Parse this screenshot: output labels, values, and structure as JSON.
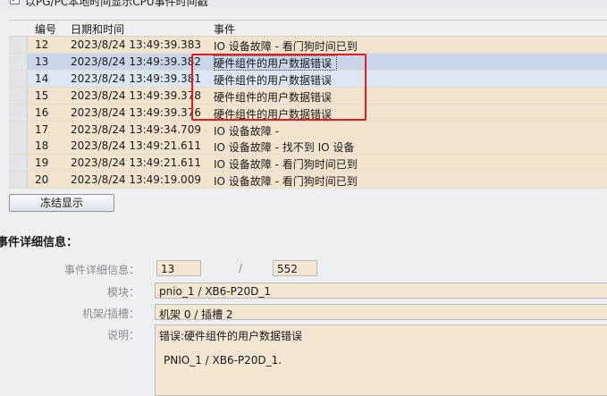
{
  "top": {
    "checkbox_mark": "✔",
    "label": "以PG/PC本地时间显示CPU事件时间戳"
  },
  "table": {
    "headers": {
      "number": "编号",
      "datetime": "日期和时间",
      "event": "事件"
    },
    "rows": [
      {
        "number": "12",
        "datetime": "2023/8/24 13:49:39.383",
        "event": "IO 设备故障 - 看门狗时间已到",
        "state": "normal"
      },
      {
        "number": "13",
        "datetime": "2023/8/24 13:49:39.382",
        "event": "硬件组件的用户数据错误",
        "state": "selected"
      },
      {
        "number": "14",
        "datetime": "2023/8/24 13:49:39.381",
        "event": "硬件组件的用户数据错误",
        "state": "highlight"
      },
      {
        "number": "15",
        "datetime": "2023/8/24 13:49:39.378",
        "event": "硬件组件的用户数据错误",
        "state": "normal"
      },
      {
        "number": "16",
        "datetime": "2023/8/24 13:49:39.376",
        "event": "硬件组件的用户数据错误",
        "state": "normal"
      },
      {
        "number": "17",
        "datetime": "2023/8/24 13:49:34.709",
        "event": "IO 设备故障 -",
        "state": "normal"
      },
      {
        "number": "18",
        "datetime": "2023/8/24 13:49:21.611",
        "event": "IO 设备故障 - 找不到 IO 设备",
        "state": "normal"
      },
      {
        "number": "19",
        "datetime": "2023/8/24 13:49:21.611",
        "event": "IO 设备故障 - 看门狗时间已到",
        "state": "normal"
      },
      {
        "number": "20",
        "datetime": "2023/8/24 13:49:19.009",
        "event": "IO 设备故障 - 看门狗时间已到",
        "state": "normal"
      }
    ]
  },
  "freeze_button": "冻结显示",
  "details": {
    "title": "事件详细信息：",
    "event_detail_label": "事件详细信息：",
    "event_index": "13",
    "separator": "/",
    "event_total": "552",
    "module_label": "模块：",
    "module_value": "pnio_1 / XB6-P20D_1",
    "rack_slot_label": "机架/插槽：",
    "rack_slot_value": "机架 0 / 插槽 2",
    "description_label": "说明：",
    "description_line1": "错误:硬件组件的用户数据错误",
    "description_line2": "PNIO_1 / XB6-P20D_1."
  },
  "colors": {
    "row_background": "#f2e3cf",
    "selected_row": "#c9d6ea",
    "highlight_row": "#dbe7f3",
    "annotation_box": "#e21b1b"
  }
}
